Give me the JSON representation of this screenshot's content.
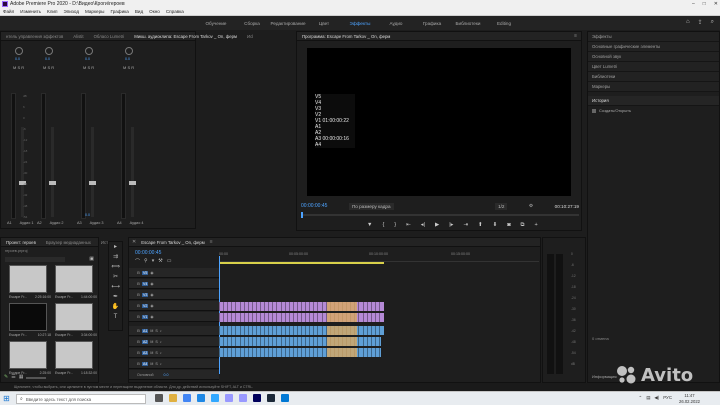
{
  "window": {
    "title": "Adobe Premiere Pro 2020 - D:\\Видео\\Кроги\\героев"
  },
  "menu": [
    "Файл",
    "Изменить",
    "Клип",
    "Эпизод",
    "Маркеры",
    "Графика",
    "Вид",
    "Окно",
    "Справка"
  ],
  "workspaces": {
    "items": [
      "Обучение",
      "Сборка",
      "Редактирование",
      "Цвет",
      "Эффекты",
      "Аудио",
      "Графика",
      "Библиотеки",
      "Editing"
    ],
    "active_index": 4
  },
  "top_left_tabs": [
    "нтель управления эффектов",
    "Аlistit",
    "Обласо Lumetri",
    "Микш. аудиоклипа: Escape From Tarkov _ On, ферм",
    "Исl"
  ],
  "mixer": {
    "channels": [
      {
        "label": "A1",
        "name": "Аудио 1",
        "pan": "0.0"
      },
      {
        "label": "A2",
        "name": "Аудио 2",
        "pan": "0.0"
      },
      {
        "label": "A3",
        "name": "Аудио 3",
        "pan": "0.0"
      },
      {
        "label": "A4",
        "name": "Аудио 4",
        "pan": "0.0"
      }
    ],
    "master_value": "0.0",
    "scale": [
      "dB",
      "6",
      "0",
      "-6",
      "-12",
      "-18",
      "-24",
      "-30",
      "-36",
      "-42",
      "-48",
      "-54"
    ]
  },
  "program": {
    "tab": "Программа: Escape From Tarkov _ On, ферм",
    "overlay": [
      "V5",
      "V4",
      "V3",
      "V2",
      "V1 01:00:00:22",
      "A1",
      "A2",
      "A3 00:00:00:16",
      "A4"
    ],
    "timecode": "00:00:00:45",
    "fit": "По размеру кадра",
    "zoom": "1/2",
    "duration": "00:10:27:19"
  },
  "right_panel": {
    "items": [
      "Эффекты",
      "Основные графические элементы",
      "Основной звук",
      "Цвет Lumetri",
      "Библиотеки",
      "Маркеры"
    ],
    "history_title": "История",
    "history_entry": "Создать/Открыть",
    "footer": [
      "0 отмена",
      "Информация"
    ]
  },
  "project": {
    "tabs": [
      "Проект: героев",
      "Браузер медиаданных",
      "Ист"
    ],
    "path": "героев.prproj",
    "items": [
      {
        "name": "Escape Fr...",
        "duration": "2:25:16:00"
      },
      {
        "name": "Escape Fr...",
        "duration": "1:44:00:00"
      },
      {
        "name": "Escape Fr...",
        "duration": "10:27:18"
      },
      {
        "name": "Escape Fr...",
        "duration": "3:34:00:00"
      },
      {
        "name": "Escape Fr...",
        "duration": "2:25:00"
      },
      {
        "name": "Escape Fr...",
        "duration": "1:18:32:00"
      }
    ]
  },
  "timeline": {
    "tab": "Escape From Tarkov _ On, ферм",
    "timecode": "00:00:00:45",
    "ruler": [
      "00:00",
      "00:05:00:00",
      "00:10:00:00",
      "00:15:00:00"
    ],
    "video_tracks": [
      "V5",
      "V4",
      "V3",
      "V2",
      "V1"
    ],
    "audio_tracks": [
      "A1",
      "A2",
      "A3",
      "A4"
    ],
    "master": "Основной",
    "master_value": "0.0"
  },
  "status": "Щелкните, чтобы выбрать, или щелкните в пустом месте и перетащите выделение области. Для др. действий используйте SHIFT, ALT и CTRL.",
  "taskbar": {
    "search_placeholder": "Введите здесь текст для поиска",
    "time": "11:47",
    "date": "26.02.2022",
    "lang": "РУС"
  },
  "watermark": "Avito",
  "colors": {
    "accent": "#4da3ff",
    "video_clip": "#b58ad6",
    "audio_clip": "#5f9fd6",
    "clip_label": "#d8a860"
  }
}
